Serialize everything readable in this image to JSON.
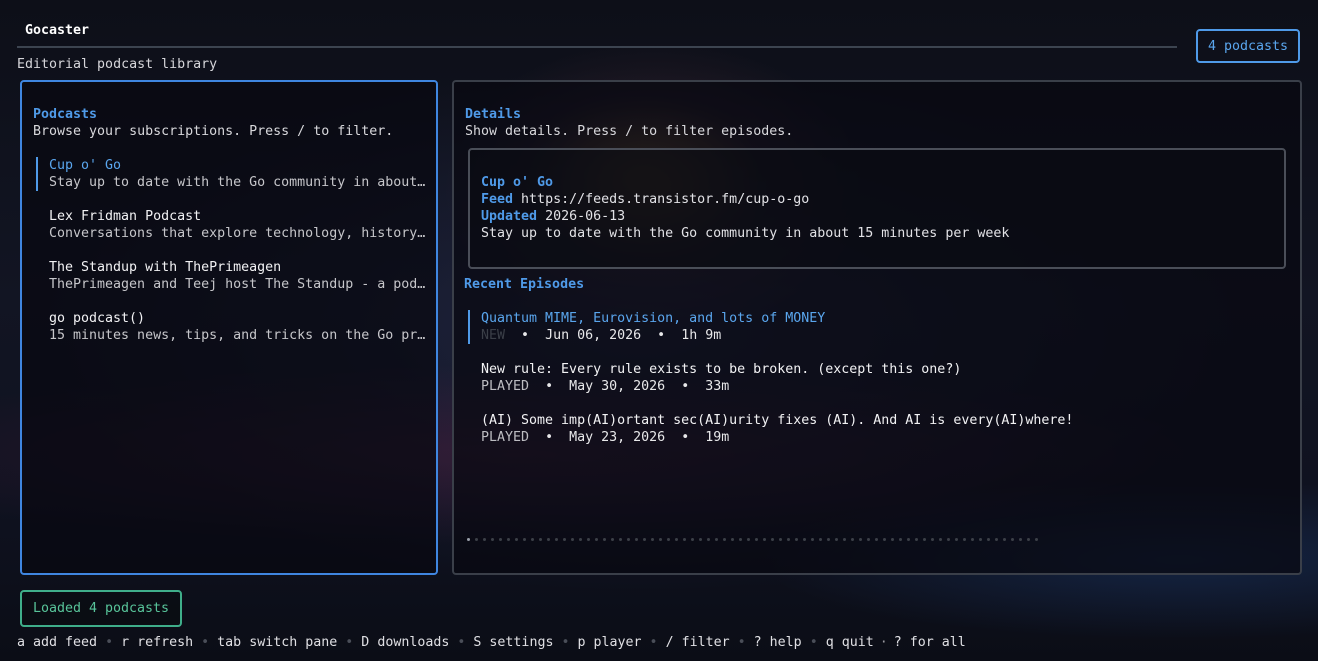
{
  "app": {
    "title": "Gocaster",
    "subtitle": "Editorial podcast library",
    "count_badge": "4 podcasts"
  },
  "podcasts_pane": {
    "heading": "Podcasts",
    "description": "Browse your subscriptions. Press / to filter.",
    "items": [
      {
        "title": "Cup o' Go",
        "description": "Stay up to date with the Go community in about 15 minutes per week",
        "selected": true
      },
      {
        "title": "Lex Fridman Podcast",
        "description": "Conversations that explore technology, history, science and the human condition",
        "selected": false
      },
      {
        "title": "The Standup with ThePrimeagen",
        "description": "ThePrimeagen and Teej host The Standup - a podcast about software",
        "selected": false
      },
      {
        "title": "go podcast()",
        "description": "15 minutes news, tips, and tricks on the Go programming language",
        "selected": false
      }
    ]
  },
  "details_pane": {
    "heading": "Details",
    "description": "Show details. Press / to filter episodes.",
    "card": {
      "title": "Cup o' Go",
      "feed_label": "Feed",
      "feed_value": "https://feeds.transistor.fm/cup-o-go",
      "updated_label": "Updated",
      "updated_value": "2026-06-13",
      "summary": "Stay up to date with the Go community in about 15 minutes per week"
    },
    "episodes_heading": "Recent Episodes",
    "episodes": [
      {
        "title": "Quantum MIME, Eurovision, and lots of MONEY",
        "status": "NEW",
        "date": "Jun 06, 2026",
        "duration": "1h 9m",
        "selected": true
      },
      {
        "title": "New rule: Every rule exists to be broken. (except this one?)",
        "status": "PLAYED",
        "date": "May 30, 2026",
        "duration": "33m",
        "selected": false
      },
      {
        "title": "(AI) Some imp(AI)ortant sec(AI)urity fixes (AI). And AI is every(AI)where!",
        "status": "PLAYED",
        "date": "May 23, 2026",
        "duration": "19m",
        "selected": false
      }
    ],
    "meta_separator": "•",
    "pagination": {
      "total_pages": 72,
      "current_page": 1
    }
  },
  "status": {
    "message": "Loaded 4 podcasts"
  },
  "help_bar": {
    "items": [
      {
        "key": "a",
        "label": "add feed"
      },
      {
        "key": "r",
        "label": "refresh"
      },
      {
        "key": "tab",
        "label": "switch pane"
      },
      {
        "key": "D",
        "label": "downloads"
      },
      {
        "key": "S",
        "label": "settings"
      },
      {
        "key": "p",
        "label": "player"
      },
      {
        "key": "/",
        "label": "filter"
      },
      {
        "key": "?",
        "label": "help"
      },
      {
        "key": "q",
        "label": "quit"
      }
    ],
    "trailing_key": "?",
    "trailing_label": "for all",
    "separator": "•",
    "trailing_separator": "·"
  },
  "colors": {
    "accent": "#4f9ae8",
    "status_ok": "#58c49a",
    "border_inactive": "#3a3f49"
  }
}
